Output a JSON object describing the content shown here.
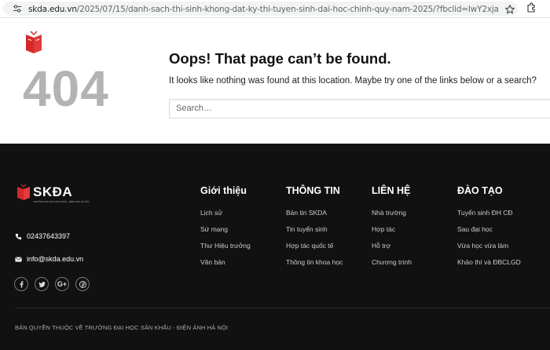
{
  "browser": {
    "url_host": "skda.edu.vn",
    "url_path": "/2025/07/15/danh-sach-thi-sinh-khong-dat-ky-thi-tuyen-sinh-dai-hoc-chinh-quy-nam-2025/?fbclid=IwY2xjawLj899leHRuA2FlbQIxMQAB..."
  },
  "error": {
    "code": "404",
    "title": "Oops! That page can’t be found.",
    "message": "It looks like nothing was found at this location. Maybe try one of the links below or a search?",
    "search_placeholder": "Search…"
  },
  "footer": {
    "logo_text": "SKĐA",
    "logo_subtext": "TRƯỜNG ĐẠI HỌC SÂN KHẤU - ĐIỆN ẢNH HÀ NỘI",
    "phone": "02437643397",
    "email": "info@skda.edu.vn",
    "socials": [
      "facebook-icon",
      "twitter-icon",
      "google-plus-icon",
      "pinterest-icon"
    ],
    "columns": [
      {
        "title": "Giới thiệu",
        "links": [
          "Lịch sử",
          "Sứ mạng",
          "Thư Hiệu trưởng",
          "Văn bản"
        ]
      },
      {
        "title": "THÔNG TIN",
        "links": [
          "Bản tin SKDA",
          "Tin tuyển sinh",
          "Hợp tác quốc tế",
          "Thông tin khoa học"
        ]
      },
      {
        "title": "LIÊN HỆ",
        "links": [
          "Nhà trường",
          "Hợp tác",
          "Hỗ trợ",
          "Chương trình"
        ]
      },
      {
        "title": "ĐÀO TẠO",
        "links": [
          "Tuyển sinh ĐH CĐ",
          "Sau đại học",
          "Vừa học vừa làm",
          "Khảo thí và ĐBCLGD"
        ]
      }
    ],
    "copyright": "BẢN QUYỀN THUỘC VỀ TRƯỜNG ĐẠI HỌC SÂN KHẤU - ĐIỆN ẢNH HÀ NỘI"
  },
  "colors": {
    "brand_red": "#d62828",
    "footer_bg": "#111111",
    "code_gray": "#b3b3b3"
  }
}
